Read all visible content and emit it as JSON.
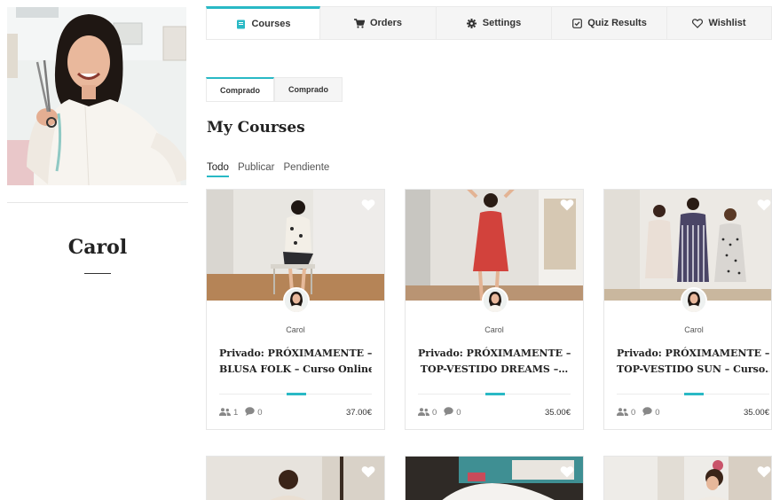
{
  "profile": {
    "name": "Carol"
  },
  "tabs": [
    {
      "label": "Courses",
      "icon": "book-icon",
      "active": true
    },
    {
      "label": "Orders",
      "icon": "cart-icon",
      "active": false
    },
    {
      "label": "Settings",
      "icon": "gear-icon",
      "active": false
    },
    {
      "label": "Quiz Results",
      "icon": "checkbox-icon",
      "active": false
    },
    {
      "label": "Wishlist",
      "icon": "heart-outline-icon",
      "active": false
    }
  ],
  "subtabs": [
    {
      "label": "Comprado",
      "active": true
    },
    {
      "label": "Comprado",
      "active": false
    }
  ],
  "section": {
    "title": "My Courses"
  },
  "filters": [
    {
      "label": "Todo",
      "active": true
    },
    {
      "label": "Publicar",
      "active": false
    },
    {
      "label": "Pendiente",
      "active": false
    }
  ],
  "courses": [
    {
      "author": "Carol",
      "title_line1": "Privado: PRÓXIMAMENTE –",
      "title_line2": "BLUSA FOLK – Curso Online…",
      "students": "1",
      "comments": "0",
      "price": "37.00€"
    },
    {
      "author": "Carol",
      "title_line1": "Privado: PRÓXIMAMENTE –",
      "title_line2": "TOP-VESTIDO DREAMS –…",
      "students": "0",
      "comments": "0",
      "price": "35.00€"
    },
    {
      "author": "Carol",
      "title_line1": "Privado: PRÓXIMAMENTE –",
      "title_line2": "TOP-VESTIDO SUN – Curso…",
      "students": "0",
      "comments": "0",
      "price": "35.00€"
    }
  ],
  "colors": {
    "accent": "#29b9c5"
  }
}
